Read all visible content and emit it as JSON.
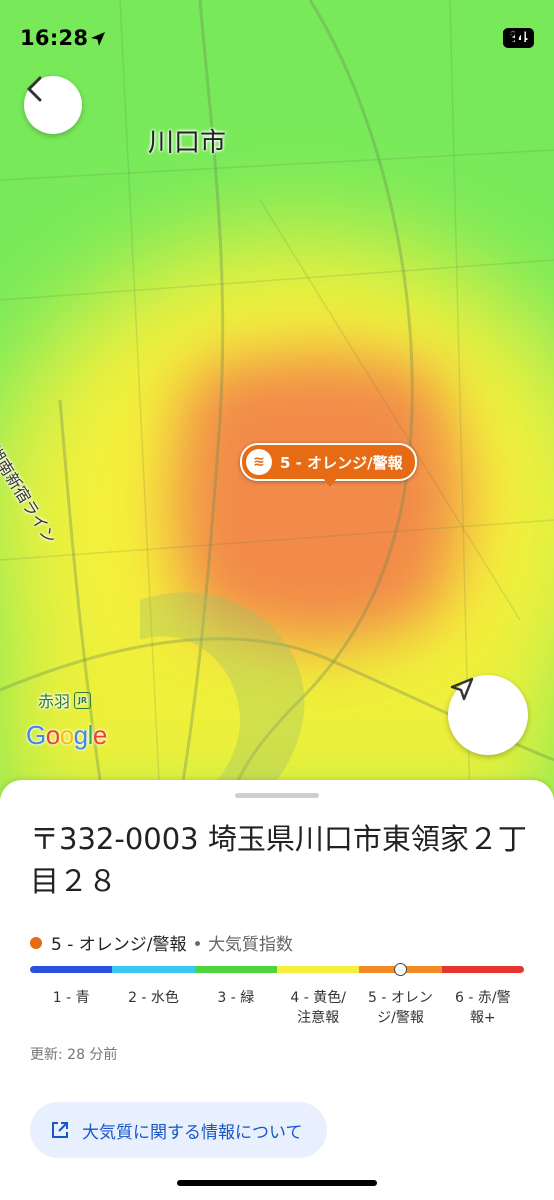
{
  "status_bar": {
    "time": "16:28",
    "battery": "94"
  },
  "map": {
    "city_label": "川口市",
    "rail_label": "湘南新宿ライン",
    "station_label": "赤羽",
    "station_badge": "JR",
    "provider": "Google",
    "aqi_pin_label": "5 - オレンジ/警報",
    "icons": {
      "back": "back-arrow-icon",
      "locate": "navigation-arrow-icon",
      "aqi": "air-waves-icon"
    }
  },
  "sheet": {
    "address": "〒332-0003 埼玉県川口市東領家２丁目２８",
    "aqi_level": "5 - オレンジ/警報",
    "aqi_index_label": "大気質指数",
    "aqi_level_value": 5,
    "scale_colors": [
      "#2950e0",
      "#39c9f0",
      "#4dd63c",
      "#f6ee3a",
      "#f28a28",
      "#e5352d"
    ],
    "levels": [
      {
        "number": "1 - 青",
        "label": ""
      },
      {
        "number": "2 - 水色",
        "label": ""
      },
      {
        "number": "3 - 緑",
        "label": ""
      },
      {
        "number": "4 - 黄色/",
        "label": "注意報"
      },
      {
        "number": "5 - オレン",
        "label": "ジ/警報"
      },
      {
        "number": "6 - 赤/警",
        "label": "報+"
      }
    ],
    "updated": "更新: 28 分前",
    "info_button": "大気質に関する情報について"
  }
}
